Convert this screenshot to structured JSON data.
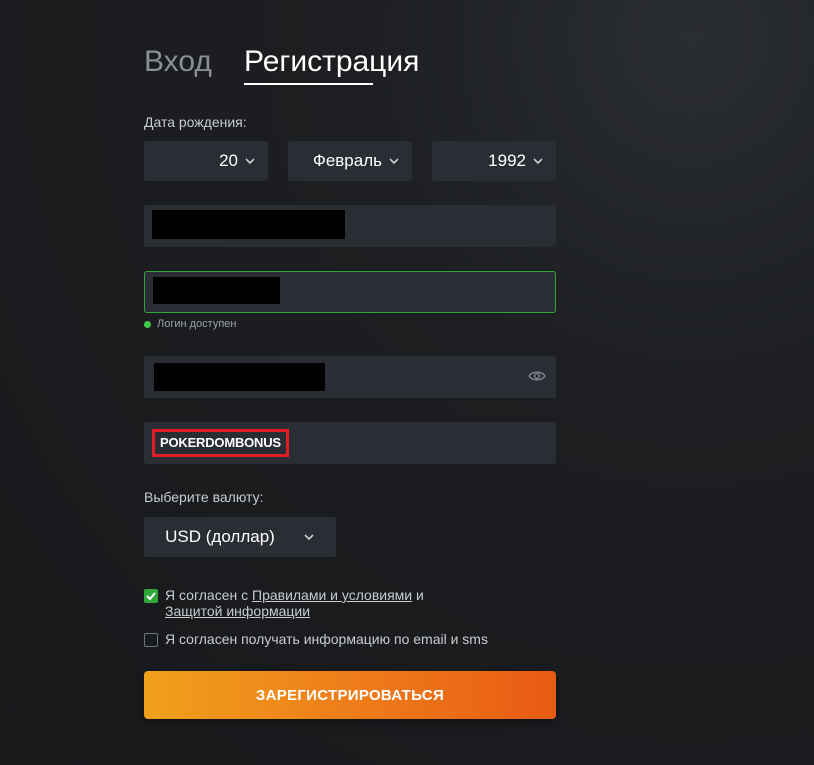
{
  "tabs": {
    "login": "Вход",
    "register": "Регистрация"
  },
  "birth_date": {
    "label": "Дата рождения:",
    "day": "20",
    "month": "Февраль",
    "year": "1992"
  },
  "login_field": {
    "status": "Логин доступен"
  },
  "promo_code": {
    "value": "POKERDOMBONUS"
  },
  "currency": {
    "label": "Выберите валюту:",
    "value": "USD (доллар)"
  },
  "terms": {
    "prefix": "Я согласен с ",
    "rules_link": "Правилами и условиями",
    "and": " и",
    "privacy_link": "Защитой информации",
    "checked": true
  },
  "newsletter": {
    "text": "Я согласен получать информацию по email и sms",
    "checked": false
  },
  "submit_label": "ЗАРЕГИСТРИРОВАТЬСЯ",
  "colors": {
    "accent_start": "#f0a01c",
    "accent_end": "#e85a14",
    "success": "#2fa83a",
    "highlight": "#e21d24"
  }
}
